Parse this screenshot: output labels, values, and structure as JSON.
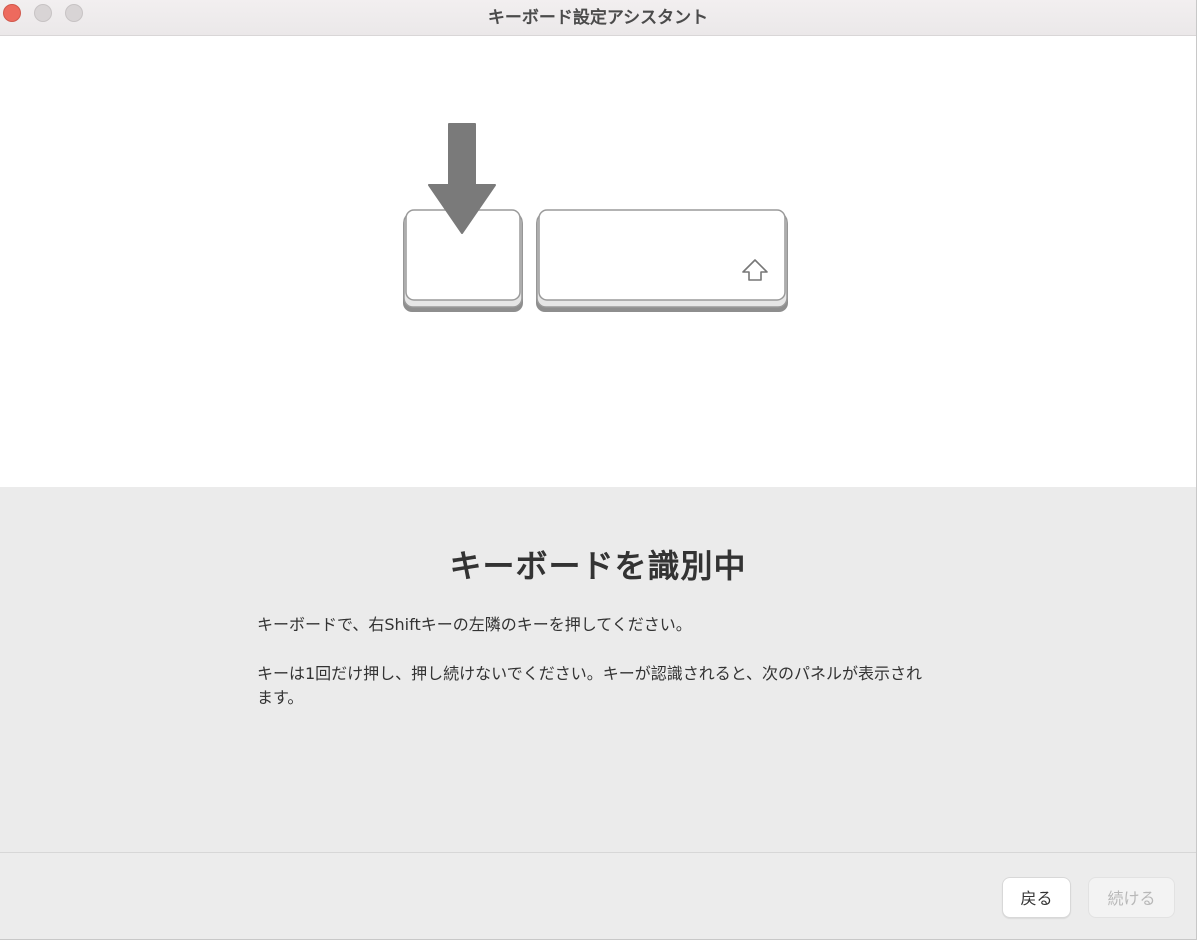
{
  "window": {
    "title": "キーボード設定アシスタント"
  },
  "illustration": {
    "arrow_icon": "down-arrow-icon",
    "shift_icon": "shift-arrow-icon"
  },
  "main": {
    "heading": "キーボードを識別中",
    "instruction_1": "キーボードで、右Shiftキーの左隣のキーを押してください。",
    "instruction_2": "キーは1回だけ押し、押し続けないでください。キーが認識されると、次のパネルが表示されます。"
  },
  "footer": {
    "back_label": "戻る",
    "continue_label": "続ける"
  },
  "colors": {
    "close": "#ed6a5e",
    "arrow": "#7a7a7a",
    "disabled_text": "#b8b8b8"
  }
}
